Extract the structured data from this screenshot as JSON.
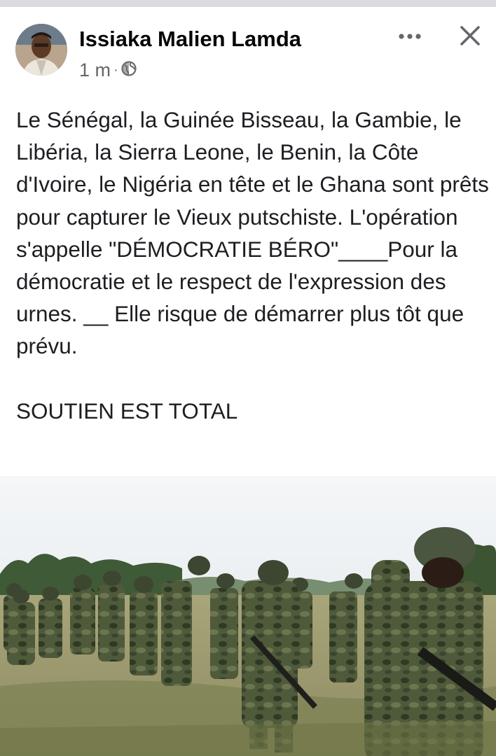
{
  "post": {
    "author": "Issiaka Malien Lamda",
    "time": "1 m",
    "separator": "·",
    "privacy_icon": "globe-icon",
    "more_icon": "more-options-icon",
    "close_icon": "close-icon",
    "paragraphs": [
      "Le Sénégal, la Guinée Bisseau, la Gambie, le Libéria, la Sierra Leone, le Benin, la Côte d'Ivoire, le Nigéria en tête et le Ghana sont prêts pour capturer le Vieux putschiste. L'opération s'appelle \"DÉMOCRATIE BÉRO\"____Pour la démocratie et le respect de l'expression des urnes. __ Elle risque de démarrer plus tôt que prévu.",
      "SOUTIEN EST TOTAL"
    ]
  },
  "colors": {
    "text": "#1c1e21",
    "meta": "#65676b",
    "strip": "#d9dbde",
    "camo": "#4e5a3a"
  }
}
